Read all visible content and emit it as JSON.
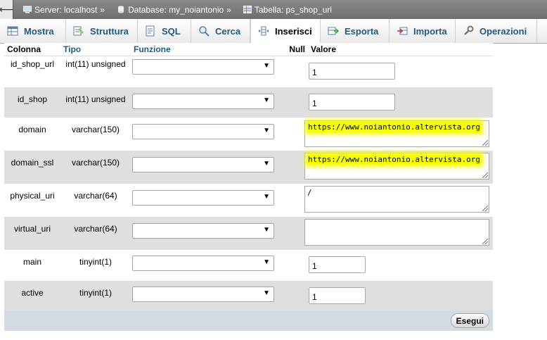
{
  "breadcrumb": {
    "server": "Server: localhost",
    "database": "Database: my_noiantonio",
    "table": "Tabella: ps_shop_url",
    "separator": "»"
  },
  "tabs": [
    {
      "label": "Mostra",
      "icon": "browse-icon"
    },
    {
      "label": "Struttura",
      "icon": "structure-icon"
    },
    {
      "label": "SQL",
      "icon": "sql-icon"
    },
    {
      "label": "Cerca",
      "icon": "search-icon"
    },
    {
      "label": "Inserisci",
      "icon": "insert-icon",
      "active": true
    },
    {
      "label": "Esporta",
      "icon": "export-icon"
    },
    {
      "label": "Importa",
      "icon": "import-icon"
    },
    {
      "label": "Operazioni",
      "icon": "wrench-icon"
    }
  ],
  "headers": {
    "colonna": "Colonna",
    "tipo": "Tipo",
    "funzione": "Funzione",
    "null": "Null",
    "valore": "Valore"
  },
  "rows": [
    {
      "name": "id_shop_url",
      "type": "int(11) unsigned",
      "value": "1"
    },
    {
      "name": "id_shop",
      "type": "int(11) unsigned",
      "value": "1"
    },
    {
      "name": "domain",
      "type": "varchar(150)",
      "value": "https://www.noiantonio.altervista.org"
    },
    {
      "name": "domain_ssl",
      "type": "varchar(150)",
      "value": "https://www.noiantonio.altervista.org"
    },
    {
      "name": "physical_uri",
      "type": "varchar(64)",
      "value": "/"
    },
    {
      "name": "virtual_uri",
      "type": "varchar(64)",
      "value": ""
    },
    {
      "name": "main",
      "type": "tinyint(1)",
      "value": "1"
    },
    {
      "name": "active",
      "type": "tinyint(1)",
      "value": "1"
    }
  ],
  "submit_label": "Esegui",
  "colors": {
    "link": "#235a81",
    "highlight": "#f6ff00",
    "footer": "#d4dbe3"
  }
}
